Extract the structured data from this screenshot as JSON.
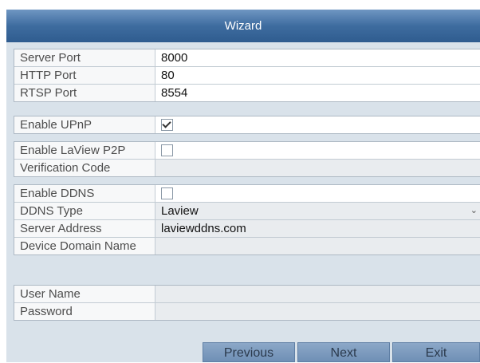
{
  "window": {
    "title": "Wizard"
  },
  "ports": [
    {
      "label": "Server Port",
      "value": "8000"
    },
    {
      "label": "HTTP Port",
      "value": "80"
    },
    {
      "label": "RTSP Port",
      "value": "8554"
    }
  ],
  "upnp": {
    "label": "Enable UPnP",
    "checked": true
  },
  "p2p": {
    "enable_label": "Enable LaView P2P",
    "verification_label": "Verification Code",
    "verification_value": ""
  },
  "ddns": {
    "enable_label": "Enable DDNS",
    "type_label": "DDNS Type",
    "type_value": "Laview",
    "server_label": "Server Address",
    "server_value": "laviewddns.com",
    "domain_label": "Device Domain Name",
    "domain_value": ""
  },
  "account": {
    "user_label": "User Name",
    "user_value": "",
    "password_label": "Password",
    "password_value": ""
  },
  "buttons": {
    "previous": "Previous",
    "next": "Next",
    "exit": "Exit"
  }
}
